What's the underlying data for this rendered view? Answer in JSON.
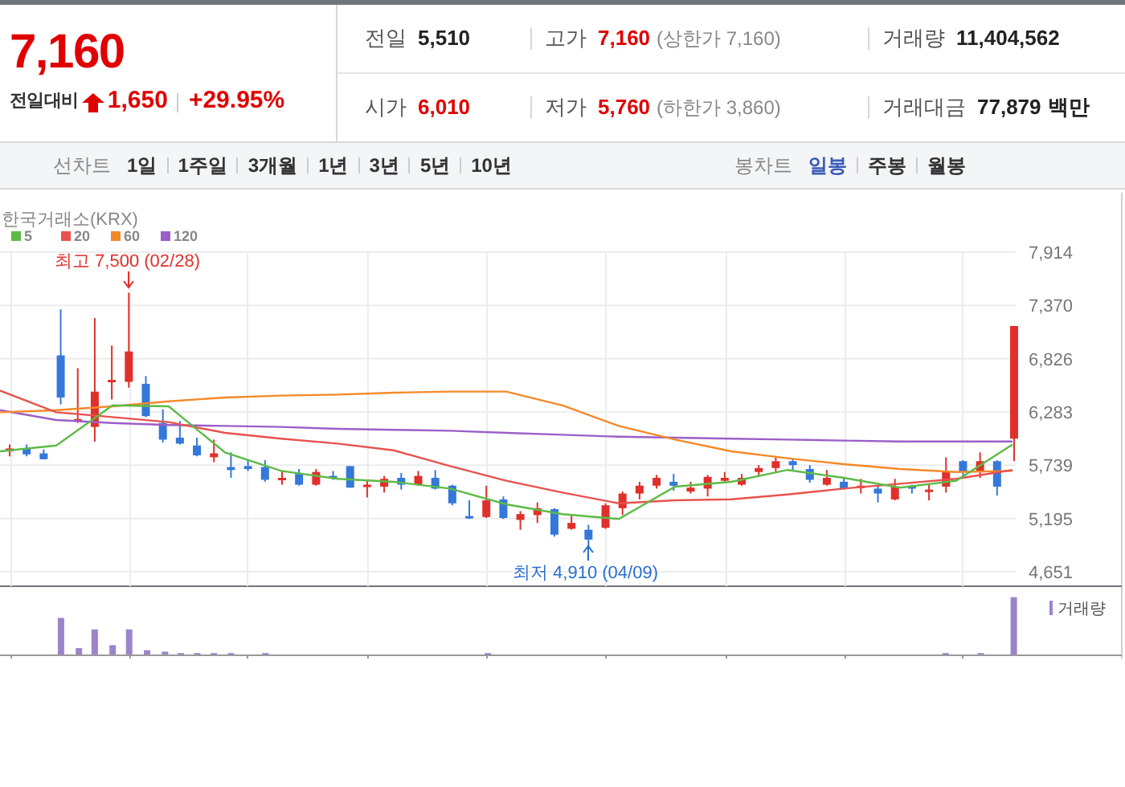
{
  "quote": {
    "price": "7,160",
    "change_label": "전일대비",
    "rising": true,
    "change": "1,650",
    "change_rate": "+29.95%"
  },
  "stats": [
    [
      {
        "label": "전일",
        "value": "5,510",
        "up": false
      },
      {
        "label": "고가",
        "value": "7,160",
        "up": true,
        "note": "(상한가 7,160)"
      },
      {
        "label": "거래량",
        "value": "11,404,562",
        "up": false
      }
    ],
    [
      {
        "label": "시가",
        "value": "6,010",
        "up": true
      },
      {
        "label": "저가",
        "value": "5,760",
        "up": true,
        "note": "(하한가 3,860)"
      },
      {
        "label": "거래대금",
        "value": "77,879",
        "up": false,
        "unit": "백만"
      }
    ]
  ],
  "toolbar": [
    {
      "label": "선차트",
      "options": [
        {
          "label": "1일",
          "selected": false
        },
        {
          "label": "1주일",
          "selected": false
        },
        {
          "label": "3개월",
          "selected": false
        },
        {
          "label": "1년",
          "selected": false
        },
        {
          "label": "3년",
          "selected": false
        },
        {
          "label": "5년",
          "selected": false
        },
        {
          "label": "10년",
          "selected": false
        }
      ]
    },
    {
      "label": "봉차트",
      "options": [
        {
          "label": "일봉",
          "selected": true
        },
        {
          "label": "주봉",
          "selected": false
        },
        {
          "label": "월봉",
          "selected": false
        }
      ]
    }
  ],
  "chart": {
    "exchange": "한국거래소(KRX)",
    "price_chart": {
      "chart_data": {
        "type": "candlestick",
        "ylim": [
          4651,
          7914
        ],
        "grid": true,
        "yticks": [
          {
            "value": 7914,
            "label": "7,914"
          },
          {
            "value": 7370,
            "label": "7,370"
          },
          {
            "value": 6826,
            "label": "6,826"
          },
          {
            "value": 6283,
            "label": "6,283"
          },
          {
            "value": 5739,
            "label": "5,739"
          },
          {
            "value": 5195,
            "label": "5,195"
          },
          {
            "value": 4651,
            "label": "4,651"
          }
        ],
        "ohlc": [
          [
            5880,
            5950,
            5830,
            5910
          ],
          [
            5910,
            5950,
            5830,
            5850
          ],
          [
            5860,
            5900,
            5800,
            5800
          ],
          [
            6860,
            7330,
            6360,
            6430
          ],
          [
            6190,
            6730,
            6170,
            6210
          ],
          [
            6130,
            7240,
            5980,
            6490
          ],
          [
            6590,
            6960,
            6410,
            6610
          ],
          [
            6590,
            7500,
            6530,
            6900
          ],
          [
            6570,
            6650,
            6230,
            6240
          ],
          [
            6170,
            6310,
            5970,
            6000
          ],
          [
            6020,
            6190,
            5950,
            5960
          ],
          [
            5940,
            6020,
            5830,
            5840
          ],
          [
            5820,
            6000,
            5770,
            5860
          ],
          [
            5720,
            5870,
            5610,
            5690
          ],
          [
            5730,
            5800,
            5680,
            5700
          ],
          [
            5720,
            5790,
            5570,
            5590
          ],
          [
            5590,
            5680,
            5540,
            5610
          ],
          [
            5650,
            5700,
            5530,
            5540
          ],
          [
            5540,
            5700,
            5530,
            5670
          ],
          [
            5630,
            5680,
            5590,
            5610
          ],
          [
            5730,
            5730,
            5510,
            5510
          ],
          [
            5520,
            5590,
            5410,
            5540
          ],
          [
            5520,
            5630,
            5460,
            5600
          ],
          [
            5610,
            5660,
            5490,
            5540
          ],
          [
            5540,
            5680,
            5530,
            5630
          ],
          [
            5610,
            5690,
            5490,
            5500
          ],
          [
            5530,
            5540,
            5330,
            5350
          ],
          [
            5220,
            5380,
            5190,
            5200
          ],
          [
            5210,
            5530,
            5200,
            5380
          ],
          [
            5390,
            5420,
            5190,
            5200
          ],
          [
            5180,
            5270,
            5080,
            5240
          ],
          [
            5230,
            5360,
            5150,
            5300
          ],
          [
            5290,
            5300,
            5010,
            5030
          ],
          [
            5090,
            5240,
            5080,
            5150
          ],
          [
            5080,
            5130,
            4910,
            4980
          ],
          [
            5100,
            5350,
            5090,
            5330
          ],
          [
            5300,
            5470,
            5230,
            5450
          ],
          [
            5450,
            5570,
            5390,
            5530
          ],
          [
            5530,
            5640,
            5500,
            5610
          ],
          [
            5570,
            5650,
            5480,
            5530
          ],
          [
            5470,
            5570,
            5450,
            5510
          ],
          [
            5500,
            5640,
            5420,
            5620
          ],
          [
            5580,
            5670,
            5570,
            5610
          ],
          [
            5540,
            5650,
            5530,
            5610
          ],
          [
            5670,
            5740,
            5620,
            5710
          ],
          [
            5710,
            5820,
            5670,
            5780
          ],
          [
            5780,
            5800,
            5690,
            5740
          ],
          [
            5700,
            5740,
            5560,
            5590
          ],
          [
            5540,
            5690,
            5530,
            5610
          ],
          [
            5570,
            5620,
            5490,
            5500
          ],
          [
            5520,
            5600,
            5450,
            5530
          ],
          [
            5500,
            5540,
            5360,
            5450
          ],
          [
            5390,
            5600,
            5380,
            5520
          ],
          [
            5530,
            5540,
            5450,
            5500
          ],
          [
            5470,
            5540,
            5380,
            5490
          ],
          [
            5520,
            5820,
            5460,
            5680
          ],
          [
            5780,
            5790,
            5620,
            5670
          ],
          [
            5670,
            5870,
            5610,
            5780
          ],
          [
            5780,
            5790,
            5430,
            5520
          ],
          [
            6010,
            7160,
            5780,
            7160
          ]
        ]
      }
    },
    "moving_averages": {
      "chart_data": {
        "type": "line",
        "ylim": [
          4651,
          7914
        ],
        "series": [
          {
            "name": "5",
            "color": "#5dbb46",
            "values": [
              5880,
              5940,
              6350,
              6340,
              5870,
              5680,
              5600,
              5570,
              5500,
              5340,
              5240,
              5190,
              5520,
              5570,
              5690,
              5610,
              5510,
              5580,
              5950
            ]
          },
          {
            "name": "20",
            "color": "#e8524f",
            "values": [
              6500,
              6280,
              6230,
              6180,
              6070,
              6010,
              5960,
              5890,
              5730,
              5580,
              5460,
              5350,
              5380,
              5390,
              5440,
              5500,
              5550,
              5600,
              5690
            ]
          },
          {
            "name": "60",
            "color": "#f5892a",
            "values": [
              6280,
              6300,
              6340,
              6390,
              6430,
              6450,
              6460,
              6480,
              6490,
              6490,
              6350,
              6140,
              6000,
              5880,
              5810,
              5750,
              5700,
              5670,
              5680
            ]
          },
          {
            "name": "120",
            "color": "#9b5fc9",
            "values": [
              6300,
              6200,
              6170,
              6150,
              6140,
              6130,
              6110,
              6100,
              6090,
              6070,
              6050,
              6030,
              6020,
              6010,
              6000,
              5990,
              5980,
              5980,
              5980
            ]
          }
        ]
      }
    },
    "high_label": "최고 7,500 (02/28)",
    "low_label": "최저 4,910 (04/09)",
    "volume_label": "거래량"
  }
}
